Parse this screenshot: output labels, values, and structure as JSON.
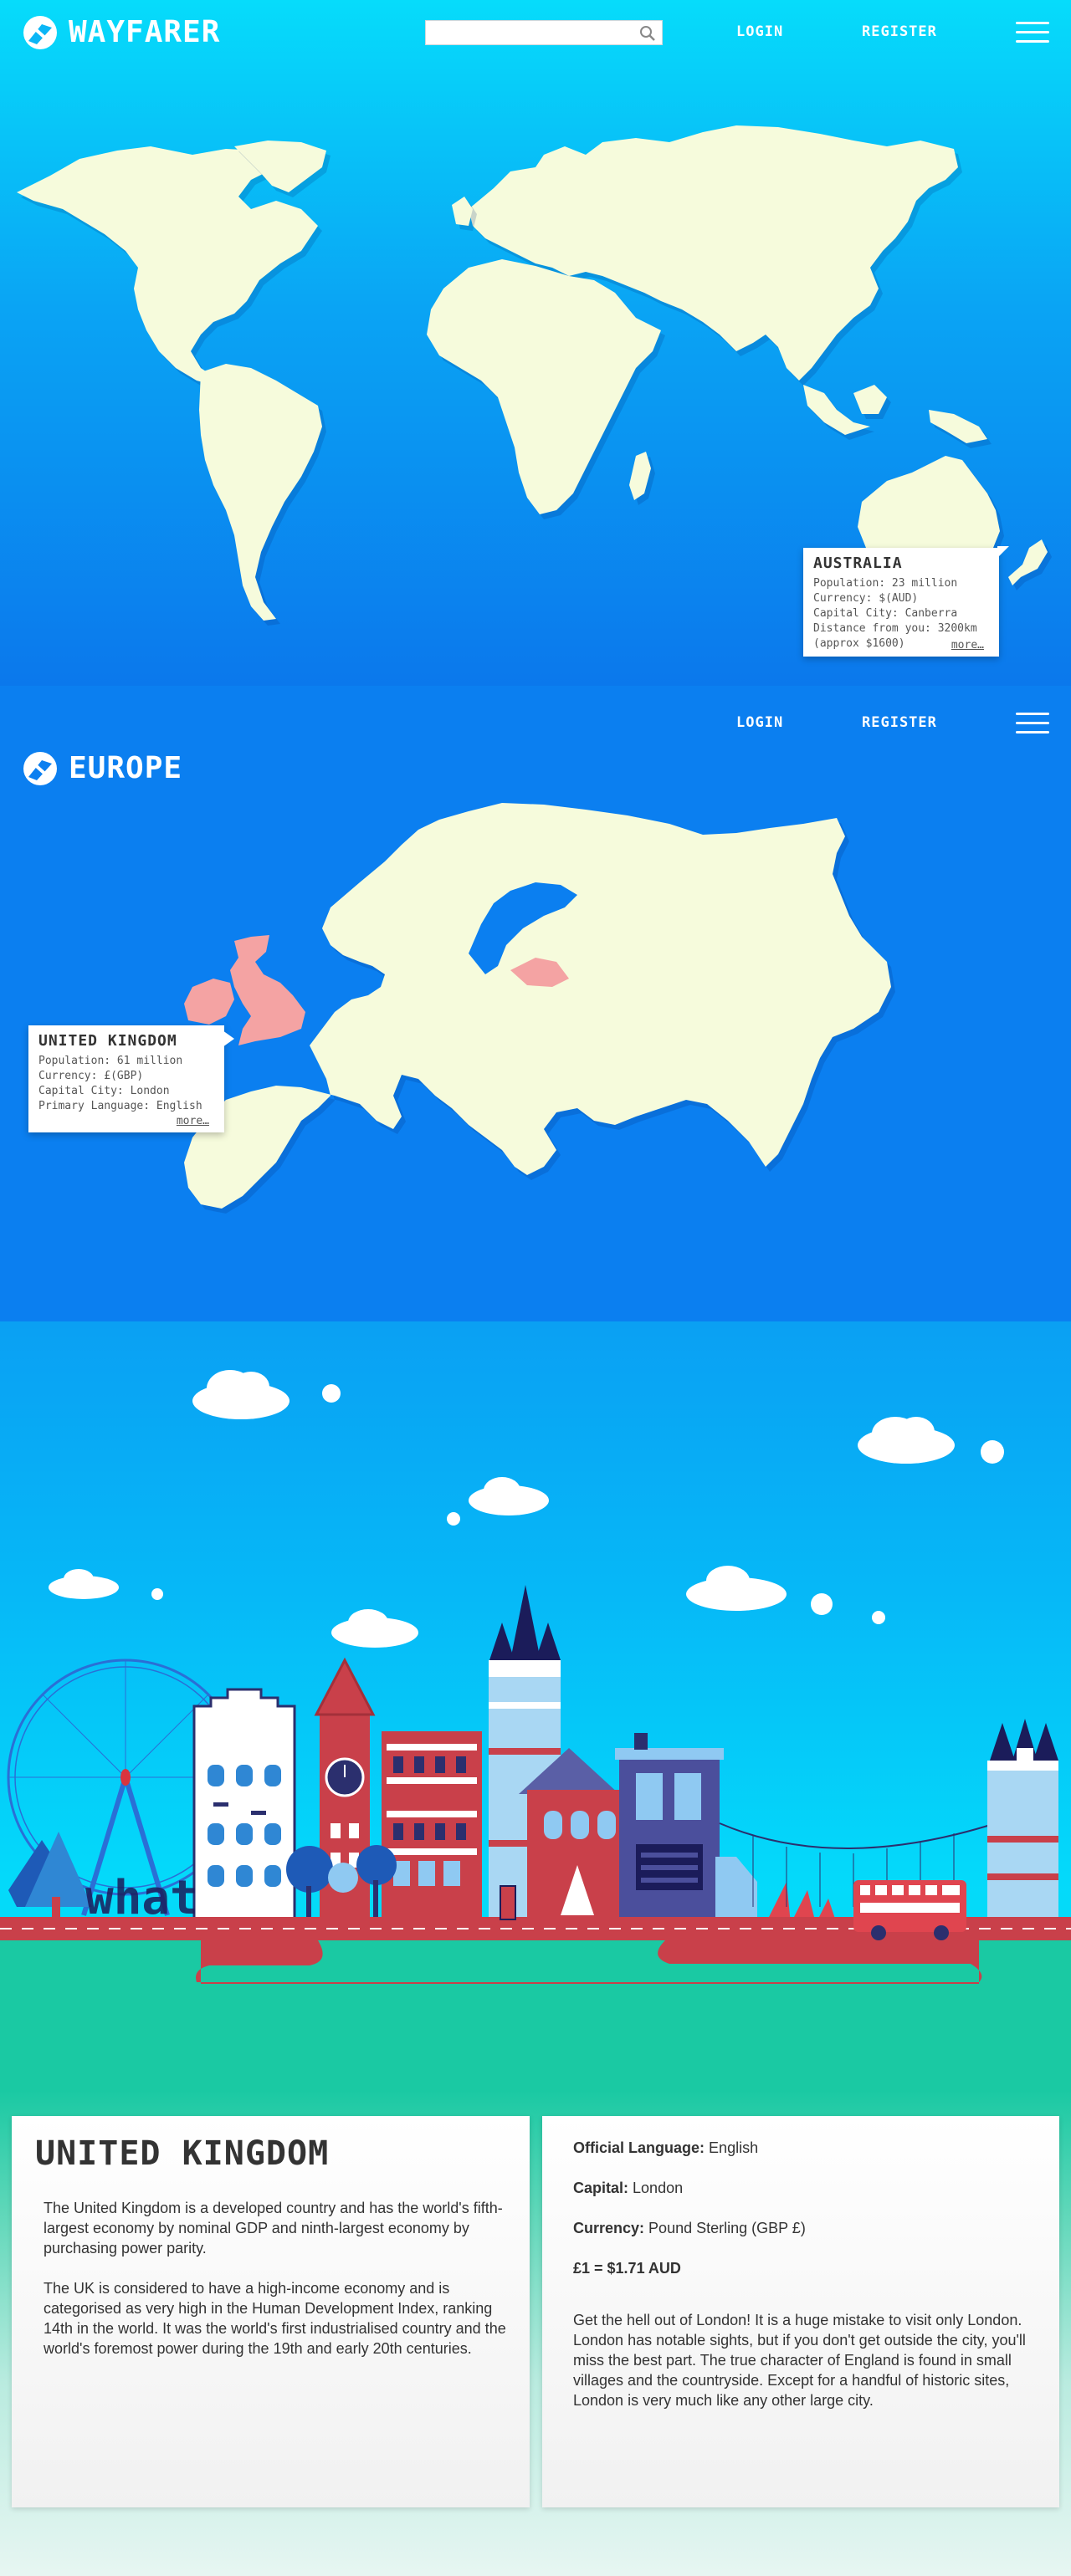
{
  "brand": {
    "name": "WAYFARER"
  },
  "header": {
    "search": {
      "placeholder": "",
      "value": ""
    },
    "login_label": "LOGIN",
    "register_label": "REGISTER"
  },
  "world_popup": {
    "title": "AUSTRALIA",
    "lines": [
      "Population: 23 million",
      "Currency: $(AUD)",
      "Capital City: Canberra",
      "Distance from you: 3200km",
      "(approx $1600)"
    ],
    "more_label": "more…"
  },
  "europe": {
    "title": "EUROPE",
    "login_label": "LOGIN",
    "register_label": "REGISTER",
    "popup": {
      "title": "UNITED KINGDOM",
      "lines": [
        "Population: 61 million",
        "Currency: £(GBP)",
        "Capital City: London",
        "Primary Language: English"
      ],
      "more_label": "more…"
    }
  },
  "city": {
    "sign_text": "what"
  },
  "info": {
    "title": "UNITED KINGDOM",
    "paragraphs": [
      "The United Kingdom is a developed country and has the world's fifth-largest economy by nominal GDP and ninth-largest economy by purchasing power parity.",
      "The UK is considered to have a high-income economy and is categorised as very high in the Human Development Index, ranking 14th in the world. It was the world's first industrialised country and the world's foremost power during the 19th and early 20th centuries."
    ],
    "facts": [
      {
        "label": "Official Language:",
        "value": "English"
      },
      {
        "label": "Capital:",
        "value": "London"
      },
      {
        "label": "Currency:",
        "value": "Pound Sterling (GBP £)"
      },
      {
        "label": "£1 = $1.71 AUD",
        "value": ""
      }
    ],
    "advice": "Get the hell out of London! It is a huge mistake to visit only London. London has notable sights, but if you don't get outside the city, you'll miss the best part. The true character of England is found in small villages and the countryside. Except for a handful of historic sites, London is very much like any other large city."
  },
  "colors": {
    "land": "#f6fbdc",
    "highlight_uk": "#f4a3a3",
    "ocean_top": "#06dcfb",
    "ocean_bottom": "#0b78ec",
    "road": "#c9404a",
    "grass": "#1ac9a3"
  },
  "icons": [
    "logo-mark-icon",
    "search-icon",
    "hamburger-menu-icon",
    "logo-mark-icon"
  ]
}
